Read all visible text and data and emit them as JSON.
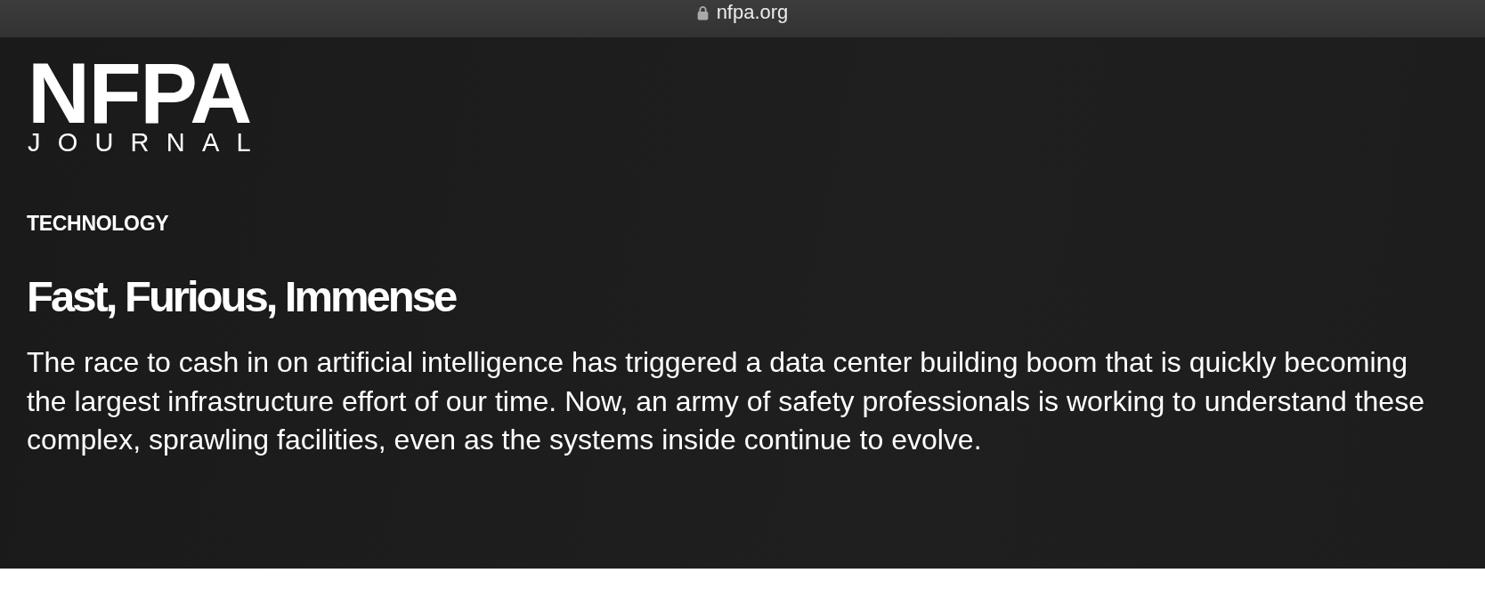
{
  "browser": {
    "url": "nfpa.org",
    "secure": true
  },
  "logo": {
    "wordmark": "NFPA",
    "subtitle": "JOURNAL"
  },
  "article": {
    "category": "TECHNOLOGY",
    "title": "Fast, Furious, Immense",
    "summary": "The race to cash in on artificial intelligence has triggered a data center building boom that is quickly becoming the largest infrastructure effort of our time. Now, an army of safety professionals is working to understand these complex, sprawling facilities, even as the systems inside continue to evolve."
  }
}
